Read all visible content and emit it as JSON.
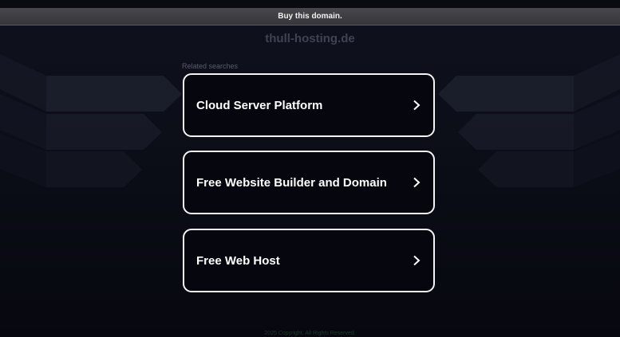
{
  "banner": {
    "buy_label": "Buy this domain."
  },
  "domain": {
    "name": "thull-hosting.de"
  },
  "related": {
    "heading": "Related searches",
    "items": [
      {
        "label": "Cloud Server Platform",
        "icon": "chevron-right-icon"
      },
      {
        "label": "Free Website Builder and Domain",
        "icon": "chevron-right-icon"
      },
      {
        "label": "Free Web Host",
        "icon": "chevron-right-icon"
      }
    ]
  },
  "footer": {
    "text": "2025 Copyright. All Rights Reserved."
  },
  "colors": {
    "background": "#0b0d16",
    "banner": "#3f3f43",
    "card_border": "#f4f4f4",
    "card_fill": "#05060e"
  }
}
